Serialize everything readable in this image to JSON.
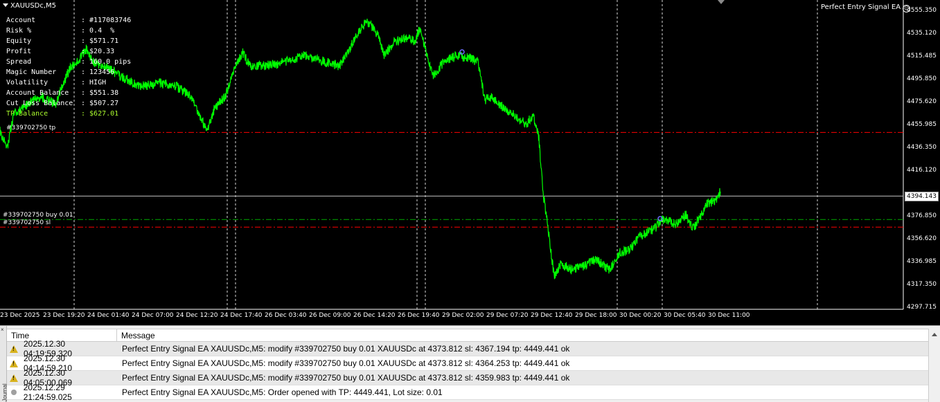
{
  "chart": {
    "symbol": "XAUUSDc,M5",
    "ea_name": "Perfect Entry Signal EA",
    "info_rows": [
      {
        "label": "Account",
        "value": ": #117083746"
      },
      {
        "label": "Risk %",
        "value": ": 0.4  %"
      },
      {
        "label": "Equity",
        "value": ": $571.71"
      },
      {
        "label": "Profit",
        "value": ": $20.33"
      },
      {
        "label": "Spread",
        "value": ": 160.0 pips"
      },
      {
        "label": "Magic Number",
        "value": ": 123456"
      },
      {
        "label": "Volatility",
        "value": ": HIGH"
      },
      {
        "label": "Account Balance",
        "value": ": $551.38"
      },
      {
        "label": "Cut Loss Balance",
        "value": ": $507.27"
      },
      {
        "label": "TP Balance",
        "value": ": $627.01"
      }
    ],
    "price_axis": [
      "4555.350",
      "4535.120",
      "4515.485",
      "4495.850",
      "4475.620",
      "4455.985",
      "4436.350",
      "4416.120",
      "4396.485",
      "4376.850",
      "4356.620",
      "4336.985",
      "4317.350",
      "4297.715"
    ],
    "current_price": "4394.143",
    "time_axis": [
      "23 Dec 2025",
      "23 Dec 19:20",
      "24 Dec 01:40",
      "24 Dec 07:00",
      "24 Dec 12:20",
      "24 Dec 17:40",
      "26 Dec 03:40",
      "26 Dec 09:00",
      "26 Dec 14:20",
      "26 Dec 19:40",
      "29 Dec 02:00",
      "29 Dec 07:20",
      "29 Dec 12:40",
      "29 Dec 18:00",
      "30 Dec 00:20",
      "30 Dec 05:40",
      "30 Dec 11:00"
    ],
    "line_labels": {
      "tp": "#339702750 tp",
      "buy": "#339702750 buy 0.01",
      "sl": "#339702750 sl"
    },
    "levels": {
      "tp": 4449.441,
      "entry": 4373.812,
      "sl": 4367.194,
      "bid": 4394.143
    },
    "colors": {
      "price": "#00ff00",
      "sl_tp": "#ff0000",
      "entry": "#00aa00",
      "grid": "#ffffff"
    }
  },
  "log": {
    "columns": [
      "Time",
      "Message"
    ],
    "rows": [
      {
        "icon": "warning-icon",
        "time": "2025.12.30 04:19:59.320",
        "message": "Perfect Entry Signal EA XAUUSDc,M5: modify #339702750 buy 0.01 XAUUSDc at 4373.812 sl: 4367.194 tp: 4449.441 ok"
      },
      {
        "icon": "warning-icon",
        "time": "2025.12.30 04:14:59.210",
        "message": "Perfect Entry Signal EA XAUUSDc,M5: modify #339702750 buy 0.01 XAUUSDc at 4373.812 sl: 4364.253 tp: 4449.441 ok"
      },
      {
        "icon": "warning-icon",
        "time": "2025.12.30 04:05:00.069",
        "message": "Perfect Entry Signal EA XAUUSDc,M5: modify #339702750 buy 0.01 XAUUSDc at 4373.812 sl: 4359.983 tp: 4449.441 ok"
      },
      {
        "icon": "info-icon",
        "time": "2025.12.29 21:24:59.025",
        "message": "Perfect Entry Signal EA XAUUSDc,M5: Order opened with TP: 4449.441, Lot size: 0.01"
      }
    ],
    "side_label": "Journal"
  }
}
